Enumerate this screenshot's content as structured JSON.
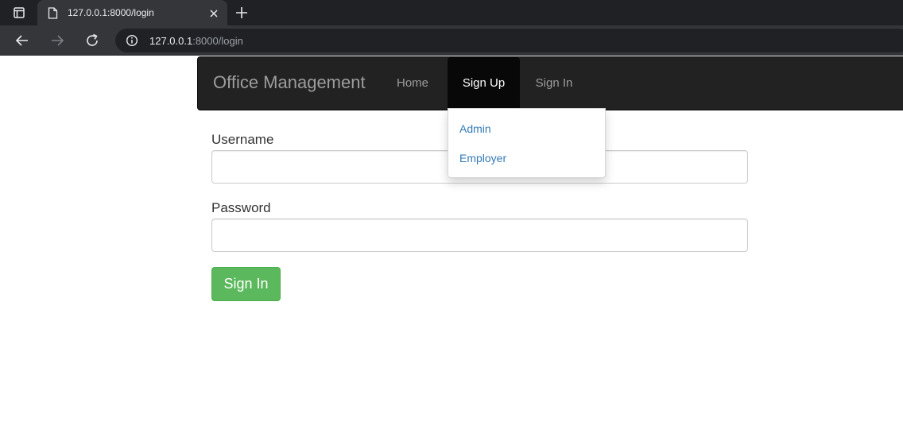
{
  "browser": {
    "tab": {
      "title": "127.0.0.1:8000/login",
      "favicon_icon": "page-icon",
      "close_icon": "close-icon"
    },
    "new_tab_icon": "plus-icon",
    "toolbar": {
      "back_icon": "back-arrow-icon",
      "forward_icon": "forward-arrow-icon",
      "reload_icon": "reload-icon",
      "site_info_icon": "info-icon"
    },
    "address": {
      "host": "127.0.0.1",
      "path": ":8000/login"
    },
    "colors": {
      "tabstrip": "#202124",
      "toolbar": "#35363a"
    }
  },
  "navbar": {
    "brand": "Office Management",
    "links": {
      "home": "Home",
      "sign_up": "Sign Up",
      "sign_in": "Sign In"
    },
    "colors": {
      "background": "#222222",
      "active": "#080808",
      "link": "#9d9d9d"
    }
  },
  "signup_dropdown": {
    "items": [
      "Admin",
      "Employer"
    ],
    "link_color": "#337ab7"
  },
  "form": {
    "username_label": "Username",
    "username_value": "",
    "password_label": "Password",
    "password_value": "",
    "submit_label": "Sign In",
    "submit_color": "#5cb85c"
  }
}
